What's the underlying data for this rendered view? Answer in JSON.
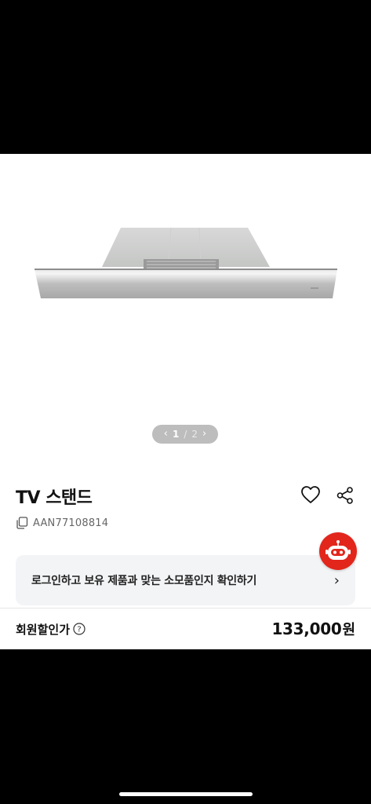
{
  "gallery": {
    "current": "1",
    "separator": "/",
    "total": "2",
    "prev_icon": "chevron-left-icon",
    "next_icon": "chevron-right-icon"
  },
  "product": {
    "title": "TV 스탠드",
    "sku": "AAN77108814"
  },
  "login_card": {
    "text": "로그인하고 보유 제품과 맞는 소모품인지 확인하기",
    "arrow": "›"
  },
  "price": {
    "label": "회원할인가",
    "amount": "133,000",
    "unit": "원"
  },
  "colors": {
    "accent": "#e2261c",
    "card_bg": "#f3f4f6",
    "pager_bg": "#bdbdbd"
  }
}
